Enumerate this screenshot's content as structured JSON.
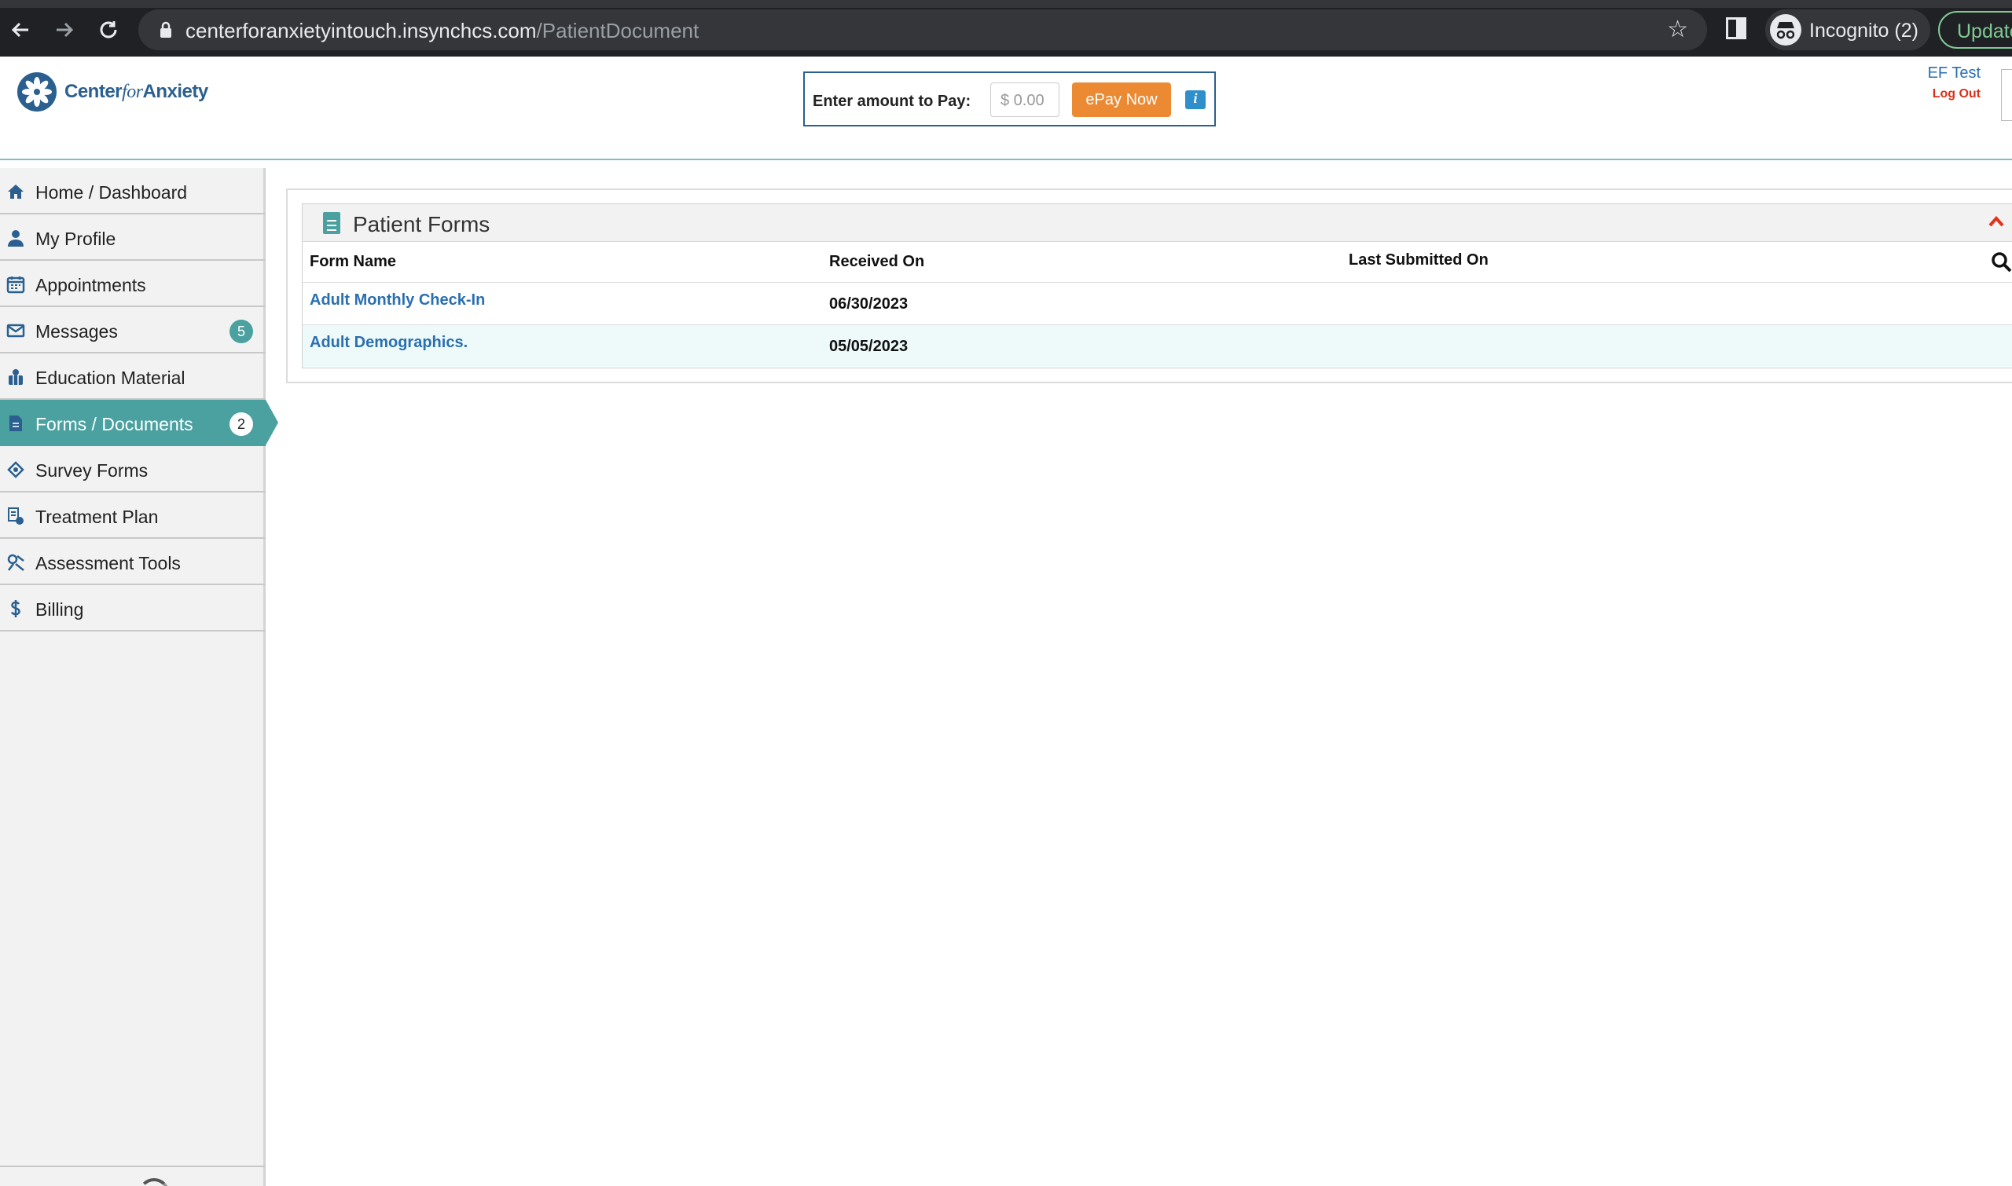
{
  "browser": {
    "url_host": "centerforanxietyintouch.insynchcs.com",
    "url_path": "/PatientDocument",
    "incognito_label": "Incognito (2)",
    "update_label": "Update"
  },
  "header": {
    "logo_text_a": "Center",
    "logo_text_b": "for",
    "logo_text_c": "Anxiety",
    "pay_label": "Enter amount to Pay:",
    "pay_placeholder": "$ 0.00",
    "pay_button": "ePay Now",
    "info_glyph": "i",
    "user_name": "EF Test",
    "logout_label": "Log Out"
  },
  "sidebar": {
    "items": [
      {
        "label": "Home / Dashboard",
        "icon": "home-icon"
      },
      {
        "label": "My Profile",
        "icon": "user-icon"
      },
      {
        "label": "Appointments",
        "icon": "calendar-icon"
      },
      {
        "label": "Messages",
        "icon": "envelope-icon",
        "badge": "5"
      },
      {
        "label": "Education Material",
        "icon": "education-icon"
      },
      {
        "label": "Forms / Documents",
        "icon": "document-icon",
        "badge": "2",
        "active": true
      },
      {
        "label": "Survey Forms",
        "icon": "survey-icon"
      },
      {
        "label": "Treatment Plan",
        "icon": "treatment-plan-icon"
      },
      {
        "label": "Assessment Tools",
        "icon": "assessment-icon"
      },
      {
        "label": "Billing",
        "icon": "dollar-icon"
      }
    ]
  },
  "forms": {
    "title": "Patient Forms",
    "columns": [
      "Form Name",
      "Received On",
      "Last Submitted On"
    ],
    "rows": [
      {
        "name": "Adult Monthly Check-In",
        "received": "06/30/2023",
        "submitted": ""
      },
      {
        "name": "Adult Demographics.",
        "received": "05/05/2023",
        "submitted": ""
      }
    ]
  },
  "colors": {
    "accent": "#4aa1a0",
    "brand": "#2a5f8f",
    "link": "#2a6fb0",
    "pay_button": "#ec8a34",
    "logout": "#d9301c"
  }
}
